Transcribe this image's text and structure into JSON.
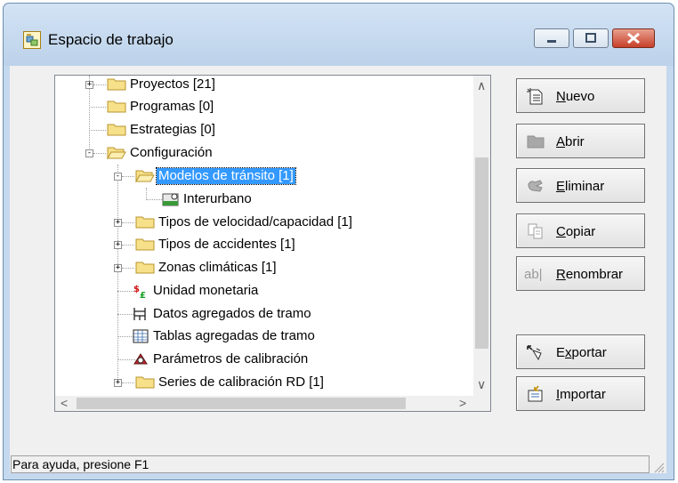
{
  "window": {
    "title": "Espacio de trabajo"
  },
  "tree": {
    "items": [
      {
        "label": "Proyectos [21]",
        "icon": "folder-icon",
        "expander": "+"
      },
      {
        "label": "Programas [0]",
        "icon": "folder-icon",
        "expander": ""
      },
      {
        "label": "Estrategias [0]",
        "icon": "folder-icon",
        "expander": ""
      },
      {
        "label": "Configuración",
        "icon": "folder-open-icon",
        "expander": "-"
      },
      {
        "label": "Modelos de tránsito [1]",
        "icon": "folder-open-icon",
        "expander": "-",
        "selected": true
      },
      {
        "label": "Interurbano",
        "icon": "traffic-model-icon",
        "expander": ""
      },
      {
        "label": "Tipos de velocidad/capacidad [1]",
        "icon": "folder-icon",
        "expander": "+"
      },
      {
        "label": "Tipos de accidentes [1]",
        "icon": "folder-icon",
        "expander": "+"
      },
      {
        "label": "Zonas climáticas [1]",
        "icon": "folder-icon",
        "expander": "+"
      },
      {
        "label": "Unidad monetaria",
        "icon": "currency-icon",
        "expander": ""
      },
      {
        "label": "Datos agregados de tramo",
        "icon": "aggregate-data-icon",
        "expander": ""
      },
      {
        "label": "Tablas agregadas de tramo",
        "icon": "aggregate-table-icon",
        "expander": ""
      },
      {
        "label": "Parámetros de calibración",
        "icon": "calibration-icon",
        "expander": ""
      },
      {
        "label": "Series de calibración RD [1]",
        "icon": "folder-icon",
        "expander": "+"
      }
    ]
  },
  "buttons": {
    "nuevo": {
      "prefix": "",
      "mnemonic": "N",
      "rest": "uevo"
    },
    "abrir": {
      "prefix": "",
      "mnemonic": "A",
      "rest": "brir"
    },
    "eliminar": {
      "prefix": "",
      "mnemonic": "E",
      "rest": "liminar"
    },
    "copiar": {
      "prefix": "",
      "mnemonic": "C",
      "rest": "opiar"
    },
    "renombrar": {
      "prefix": "",
      "mnemonic": "R",
      "rest": "enombrar"
    },
    "exportar": {
      "prefix": "E",
      "mnemonic": "x",
      "rest": "portar"
    },
    "importar": {
      "prefix": "",
      "mnemonic": "I",
      "rest": "mportar"
    }
  },
  "rename_icon_text": "ab|",
  "status": {
    "text": "Para ayuda, presione F1"
  },
  "colors": {
    "selection": "#3399ff",
    "close_button": "#c7402a",
    "titlebar": "#c4d8ee"
  }
}
